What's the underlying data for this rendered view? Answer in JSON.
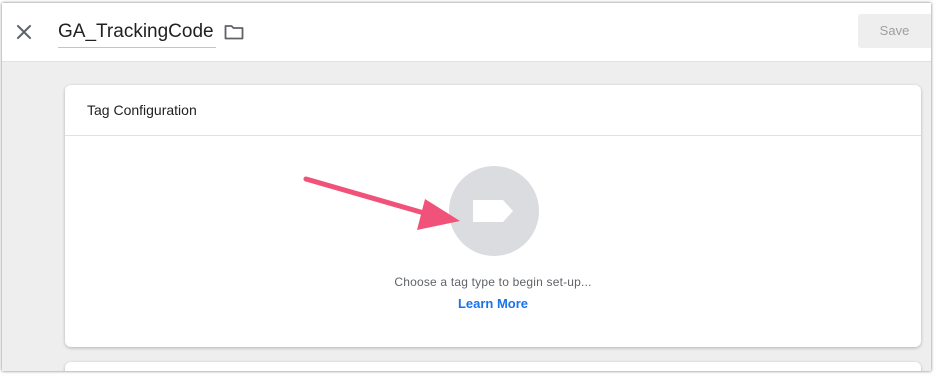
{
  "header": {
    "title": "GA_TrackingCode",
    "save_label": "Save",
    "close_icon": "close-icon",
    "folder_icon": "folder-icon"
  },
  "tag_configuration": {
    "title": "Tag Configuration",
    "prompt": "Choose a tag type to begin set-up...",
    "learn_more": "Learn More",
    "tag_icon": "tag-icon"
  },
  "colors": {
    "link": "#1a73e8",
    "annotation_arrow": "#f0527a",
    "tag_circle": "#dadce0"
  }
}
